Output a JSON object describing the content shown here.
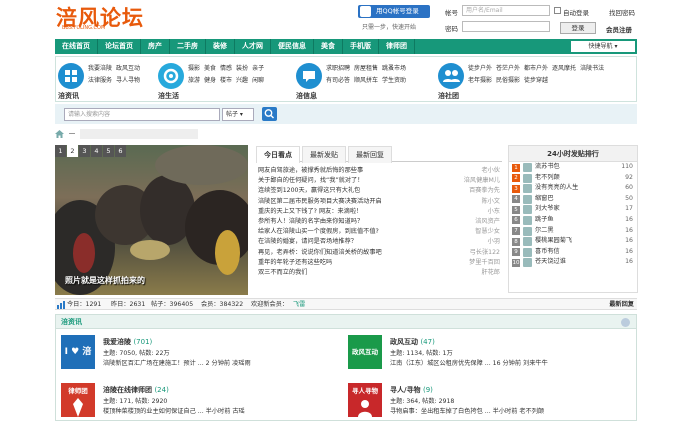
{
  "header": {
    "logo": "涪风论坛",
    "logo_sub": "BBS.FULING.COM",
    "qq_login": "用QQ帐号登录",
    "tip": "只需一步，快速开始",
    "account_label": "帐号",
    "account_placeholder": "用户名/Email",
    "auto_login": "自动登录",
    "forgot": "找回密码",
    "password_label": "密码",
    "login_button": "登录",
    "register": "会员注册"
  },
  "nav": {
    "items": [
      "在线首页",
      "论坛首页",
      "房产",
      "二手房",
      "装修",
      "人才网",
      "便民信息",
      "美食",
      "手机版",
      "律师团"
    ],
    "quick": "快捷导航"
  },
  "subnav": {
    "blocks": [
      {
        "title": "涪资讯",
        "links": [
          "我要涪陵",
          "政风互动",
          "法律服务",
          "寻人寻物"
        ]
      },
      {
        "title": "涪生活",
        "links": [
          "摄影",
          "美食",
          "情感",
          "装扮",
          "亲子",
          "旅游",
          "健身",
          "楼市",
          "兴趣",
          "闲聊"
        ]
      },
      {
        "title": "涪信息",
        "links": [
          "求职招聘",
          "房屋租售",
          "跳蚤市场",
          "有司必答",
          "顺风拼车",
          "学生资助"
        ]
      },
      {
        "title": "涪社团",
        "links": [
          "徒步户外",
          "苍茫户外",
          "都市户外",
          "逐风摩托",
          "涪陵书法",
          "老年摄影",
          "民俗摄影",
          "徒步穿越"
        ]
      }
    ]
  },
  "search": {
    "placeholder": "请输入搜索内容",
    "scope": "帖子"
  },
  "photo": {
    "pages": [
      "1",
      "2",
      "3",
      "4",
      "5",
      "6"
    ],
    "caption": "照片就是这样抓拍来的"
  },
  "tabs": [
    "今日看点",
    "最新发贴",
    "最新回复"
  ],
  "news": [
    {
      "title": "网友自驾旅途，被撑秀就后悔的那些事",
      "author": "老小伙"
    },
    {
      "title": "关于鄙自的任何疑问，找“我”就对了！",
      "author": "涪风健康M儿"
    },
    {
      "title": "连续签到1200天，赢得这只有大礼包",
      "author": "百赛拳为先"
    },
    {
      "title": "涪陵区第二届市民服务项目大赛决赛活动开启",
      "author": "陈小文"
    },
    {
      "title": "重庆的天上又下钱了? 网友：来滴啦！",
      "author": "小东"
    },
    {
      "title": "参所有人！涪陵的名字由来你知道吗？",
      "author": "涪风资产"
    },
    {
      "title": "给家人在涪陵山买一个度假房，到底值不值?",
      "author": "智慧少女"
    },
    {
      "title": "在涪陵的婚宴，请问是否场地推荐？",
      "author": "小羽"
    },
    {
      "title": "再见，老弄桥：说说你们知道涪关桥的故事吧",
      "author": "弓长张122"
    },
    {
      "title": "重年的年轮子还有这些吃吗",
      "author": "梦里千百回"
    },
    {
      "title": "双三不而立的我们",
      "author": "肝花郎"
    }
  ],
  "rank": {
    "title": "24小时发贴排行",
    "rows": [
      {
        "name": "流苏书包",
        "count": "110"
      },
      {
        "name": "老不列颠",
        "count": "92"
      },
      {
        "name": "没有亮亮的人生",
        "count": "60"
      },
      {
        "name": "缩窗巴",
        "count": "50"
      },
      {
        "name": "刘大爷家",
        "count": "17"
      },
      {
        "name": "跳子鱼",
        "count": "16"
      },
      {
        "name": "尔二黑",
        "count": "16"
      },
      {
        "name": "樱桃果园菊飞",
        "count": "16"
      },
      {
        "name": "喜币有信",
        "count": "16"
      },
      {
        "name": "苍天饶过谁",
        "count": "16"
      }
    ]
  },
  "stats": {
    "today": "今日：1291",
    "yesterday": "昨日：2631",
    "posts": "帖子：396405",
    "members": "会员：384322",
    "welcome": "欢迎新会员：",
    "new_member": "飞雷",
    "latest": "最新回复"
  },
  "section": {
    "title": "涪资讯",
    "forums": [
      {
        "name": "我爱涪陵",
        "count": "(701)",
        "line1": "主题: 7050, 帖数: 22万",
        "line2": "涪陵新区百汇广场在建施工！预计 ... 2 分钟前 凌瑶雨",
        "icon_text": "I ♥ 涪陵",
        "color": "#1f6fb8"
      },
      {
        "name": "政风互动",
        "count": "(47)",
        "line1": "主题: 1134, 帖数: 1万",
        "line2": "江南（江东）城区公租房优先保障 ... 16 分钟前 刘来牛牛",
        "icon_text": "政风互动",
        "color": "#1a9a4a"
      },
      {
        "name": "涪陵在线律师团",
        "count": "(24)",
        "line1": "主题: 171, 帖数: 2920",
        "line2": "楼顶种菜楼顶的业主如何保证自己 ... 半小时前 古瑶",
        "icon_text": "律师团",
        "color": "#d23a2a"
      },
      {
        "name": "寻人/寻物",
        "count": "(9)",
        "line1": "主题: 364, 帖数: 2918",
        "line2": "寻物启事：坐出租车掉了白色挎包 ... 半小时前 老不列颠",
        "icon_text": "寻人寻物",
        "color": "#c8282a"
      }
    ]
  }
}
